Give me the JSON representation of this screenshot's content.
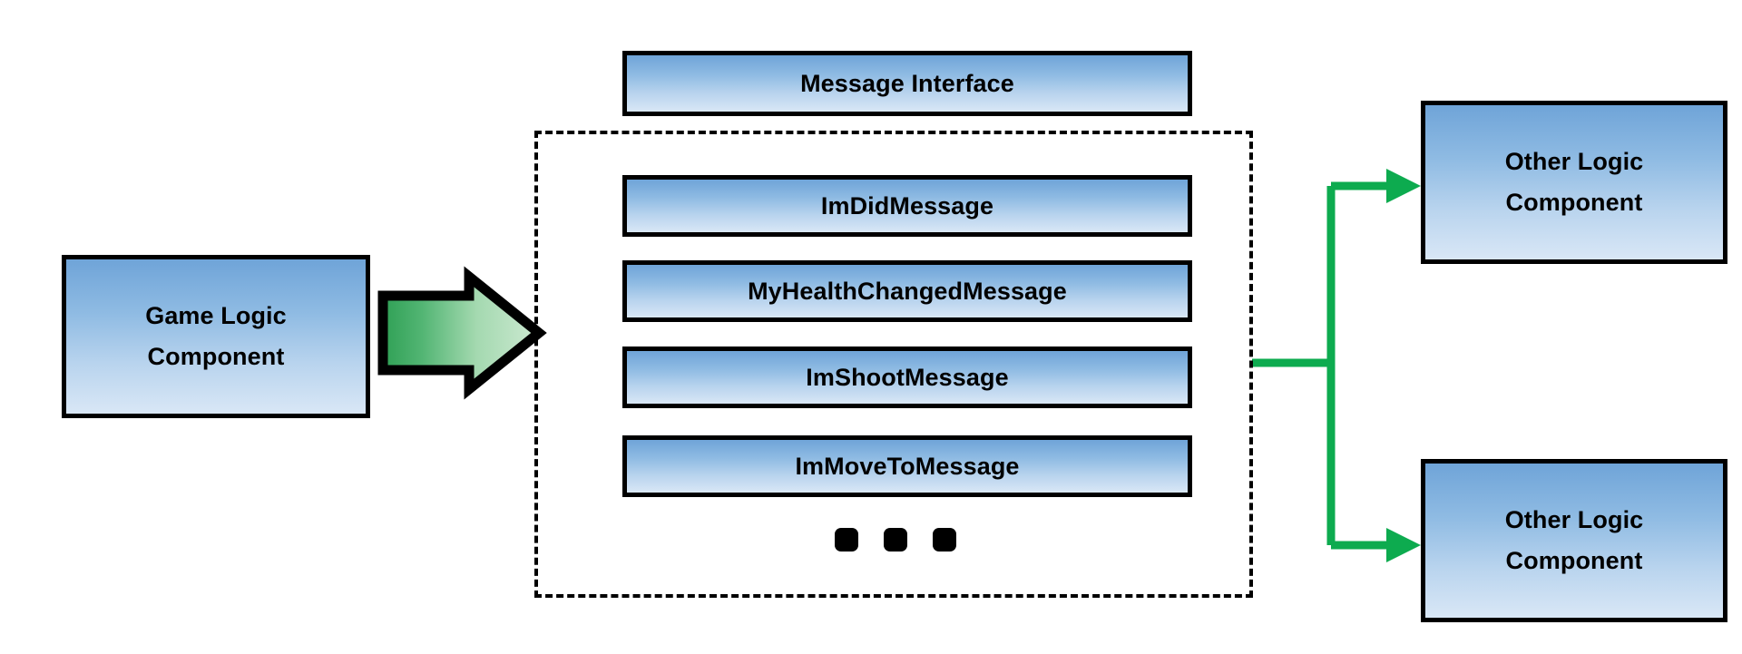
{
  "diagram": {
    "title": "Game Logic Component messaging architecture",
    "colors": {
      "node_fill_top": "#6FA4D8",
      "node_fill_bottom": "#D9E7F6",
      "node_border": "#000000",
      "connector_green": "#0DAB4F",
      "block_arrow_gradient_start": "#3AAA5E",
      "block_arrow_gradient_end": "#C9E7CD",
      "background": "#FFFFFF"
    }
  },
  "source": {
    "name": "game-logic-component",
    "line1": "Game Logic",
    "line2": "Component"
  },
  "block_arrow": {
    "name": "flow-arrow",
    "direction": "right"
  },
  "message_interface": {
    "label": "Message Interface"
  },
  "message_group": {
    "messages": [
      {
        "label": "ImDidMessage"
      },
      {
        "label": "MyHealthChangedMessage"
      },
      {
        "label": "ImShootMessage"
      },
      {
        "label": "ImMoveToMessage"
      }
    ],
    "ellipsis": "•••",
    "dot_count": 3
  },
  "targets": [
    {
      "name": "other-logic-component-top",
      "line1": "Other Logic",
      "line2": "Component"
    },
    {
      "name": "other-logic-component-bottom",
      "line1": "Other Logic",
      "line2": "Component"
    }
  ]
}
